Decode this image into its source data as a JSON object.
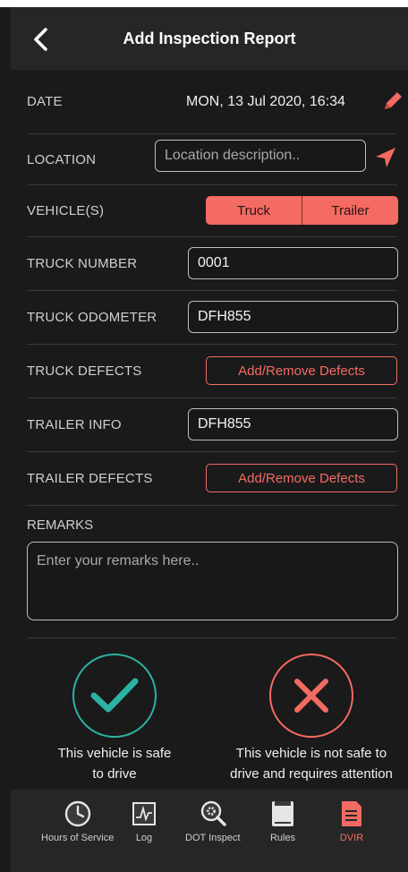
{
  "header": {
    "title": "Add Inspection Report"
  },
  "form": {
    "date": {
      "label": "DATE",
      "value": "MON, 13 Jul 2020, 16:34"
    },
    "location": {
      "label": "LOCATION",
      "placeholder": "Location description.."
    },
    "vehicles": {
      "label": "VEHICLE(S)",
      "options": [
        "Truck",
        "Trailer"
      ]
    },
    "truck_number": {
      "label": "TRUCK NUMBER",
      "value": "0001"
    },
    "truck_odometer": {
      "label": "TRUCK ODOMETER",
      "value": "DFH855"
    },
    "truck_defects": {
      "label": "TRUCK DEFECTS",
      "button": "Add/Remove Defects"
    },
    "trailer_info": {
      "label": "TRAILER INFO",
      "value": "DFH855"
    },
    "trailer_defects": {
      "label": "TRAILER DEFECTS",
      "button": "Add/Remove Defects"
    },
    "remarks": {
      "label": "REMARKS",
      "placeholder": "Enter your remarks here.."
    }
  },
  "safety": {
    "safe": {
      "line1": "This vehicle is safe",
      "line2": "to drive",
      "color": "#2bb3a3"
    },
    "unsafe": {
      "line1": "This vehicle is not safe to",
      "line2": "drive and requires attention",
      "color": "#f36b62"
    }
  },
  "tabs": [
    {
      "label": "Hours of Service",
      "icon": "clock-icon"
    },
    {
      "label": "Log",
      "icon": "chart-icon"
    },
    {
      "label": "DOT Inspect",
      "icon": "magnifier-gear-icon"
    },
    {
      "label": "Rules",
      "icon": "book-icon"
    },
    {
      "label": "DVIR",
      "icon": "document-icon",
      "active": true
    }
  ],
  "colors": {
    "accent": "#f36b62",
    "safe": "#2bb3a3",
    "background": "#1a1a1a",
    "header": "#262626"
  }
}
